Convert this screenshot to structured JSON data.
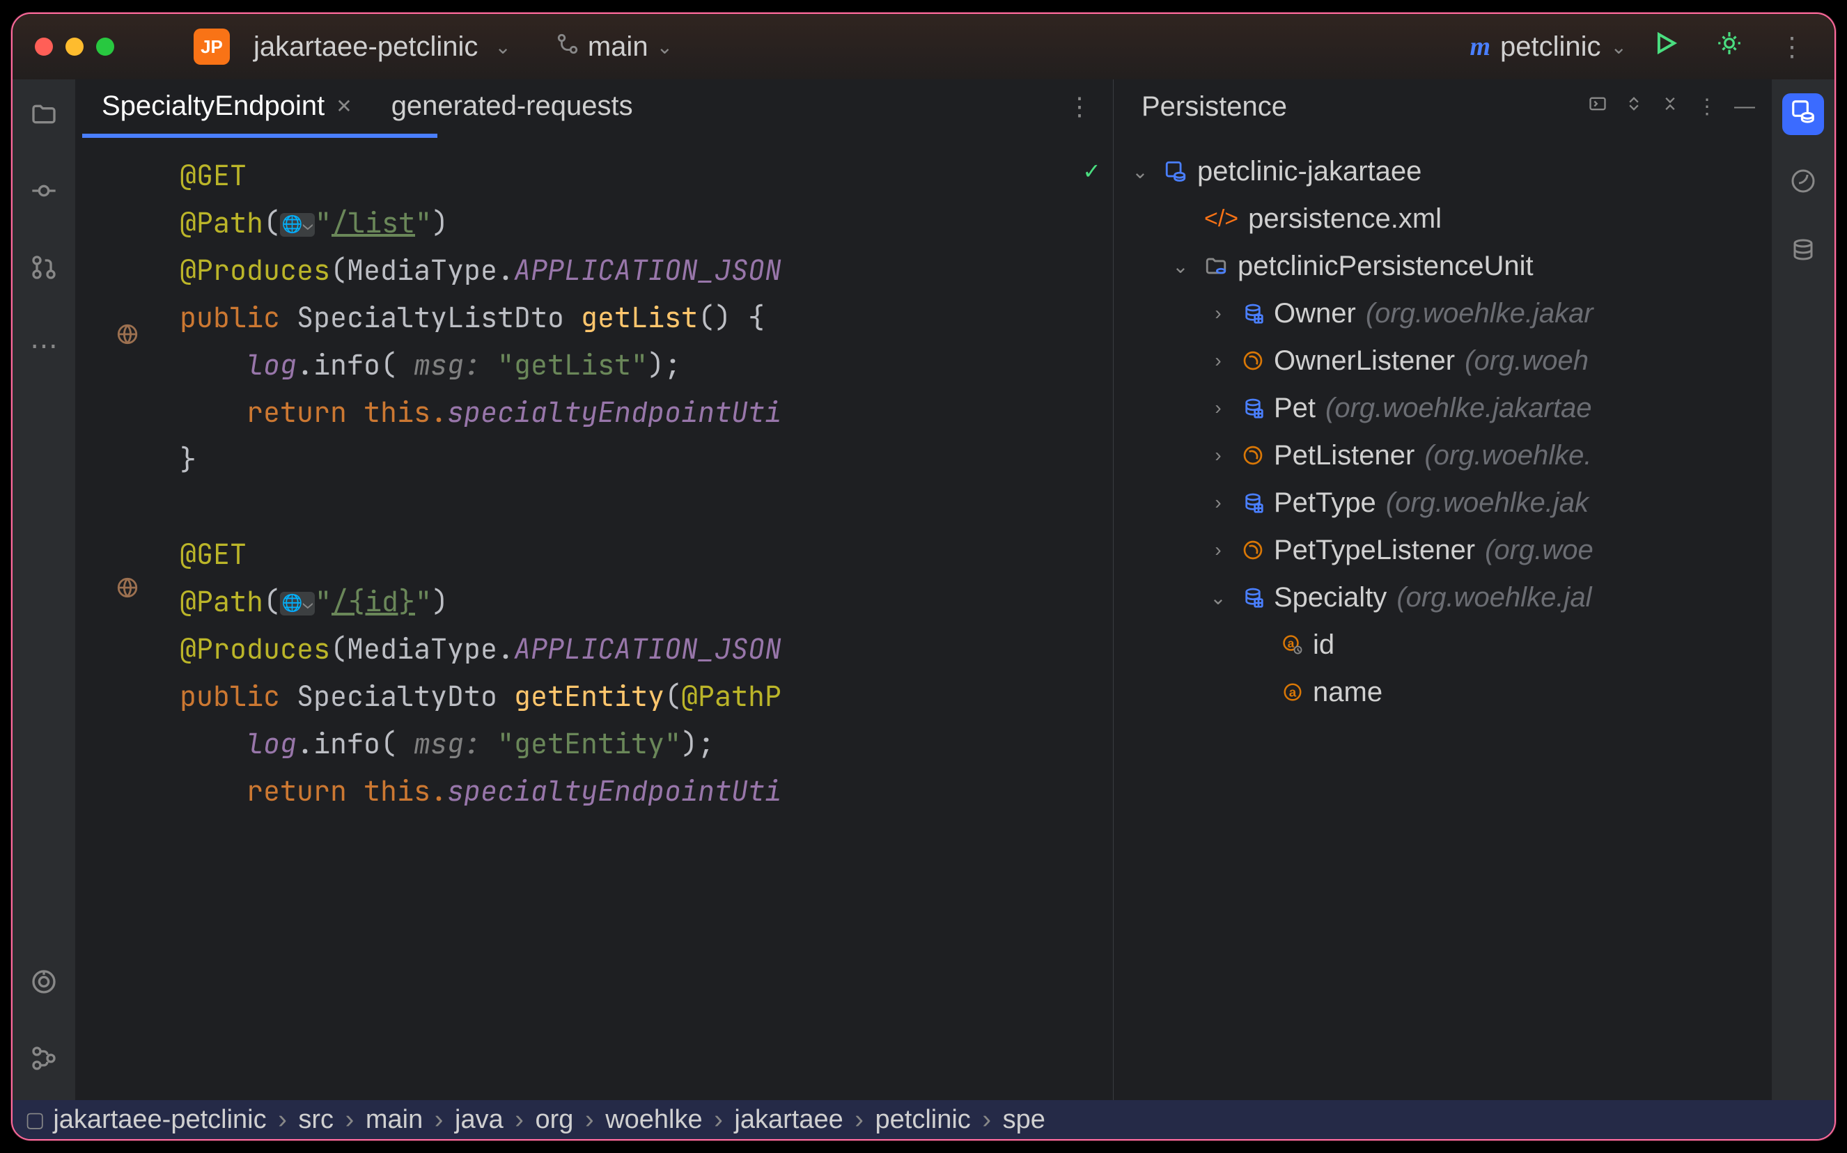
{
  "titlebar": {
    "project_initials": "JP",
    "project_name": "jakartaee-petclinic",
    "branch": "main",
    "run_config": "petclinic"
  },
  "tabs": [
    {
      "label": "SpecialtyEndpoint",
      "active": true,
      "closable": true
    },
    {
      "label": "generated-requests",
      "active": false,
      "closable": false
    }
  ],
  "code": {
    "ann_get": "@GET",
    "ann_path": "@Path",
    "path1": "/list",
    "path2": "/{id}",
    "ann_produces": "@Produces",
    "produces_arg": "MediaType.",
    "produces_const": "APPLICATION_JSON",
    "public": "public",
    "type1": "SpecialtyListDto",
    "method1": "getList",
    "type2": "SpecialtyDto",
    "method2": "getEntity",
    "pathp": "@PathP",
    "log_field": "log",
    "info_call": ".info(",
    "msg_hint": " msg: ",
    "msg1": "\"getList\"",
    "msg2": "\"getEntity\"",
    "return": "return",
    "this": "this.",
    "field": "specialtyEndpointUti"
  },
  "persistence": {
    "title": "Persistence",
    "root": "petclinic-jakartaee",
    "xml": "persistence.xml",
    "unit": "petclinicPersistenceUnit",
    "entities": [
      {
        "name": "Owner",
        "pkg": "(org.woehlke.jakar",
        "type": "entity"
      },
      {
        "name": "OwnerListener",
        "pkg": "(org.woeh",
        "type": "listener"
      },
      {
        "name": "Pet",
        "pkg": "(org.woehlke.jakartae",
        "type": "entity"
      },
      {
        "name": "PetListener",
        "pkg": "(org.woehlke.",
        "type": "listener"
      },
      {
        "name": "PetType",
        "pkg": "(org.woehlke.jak",
        "type": "entity"
      },
      {
        "name": "PetTypeListener",
        "pkg": "(org.woe",
        "type": "listener"
      },
      {
        "name": "Specialty",
        "pkg": "(org.woehlke.jal",
        "type": "entity",
        "expanded": true
      }
    ],
    "attrs": [
      {
        "name": "id",
        "key": true
      },
      {
        "name": "name",
        "key": false
      }
    ]
  },
  "breadcrumbs": [
    "jakartaee-petclinic",
    "src",
    "main",
    "java",
    "org",
    "woehlke",
    "jakartaee",
    "petclinic",
    "spe"
  ]
}
